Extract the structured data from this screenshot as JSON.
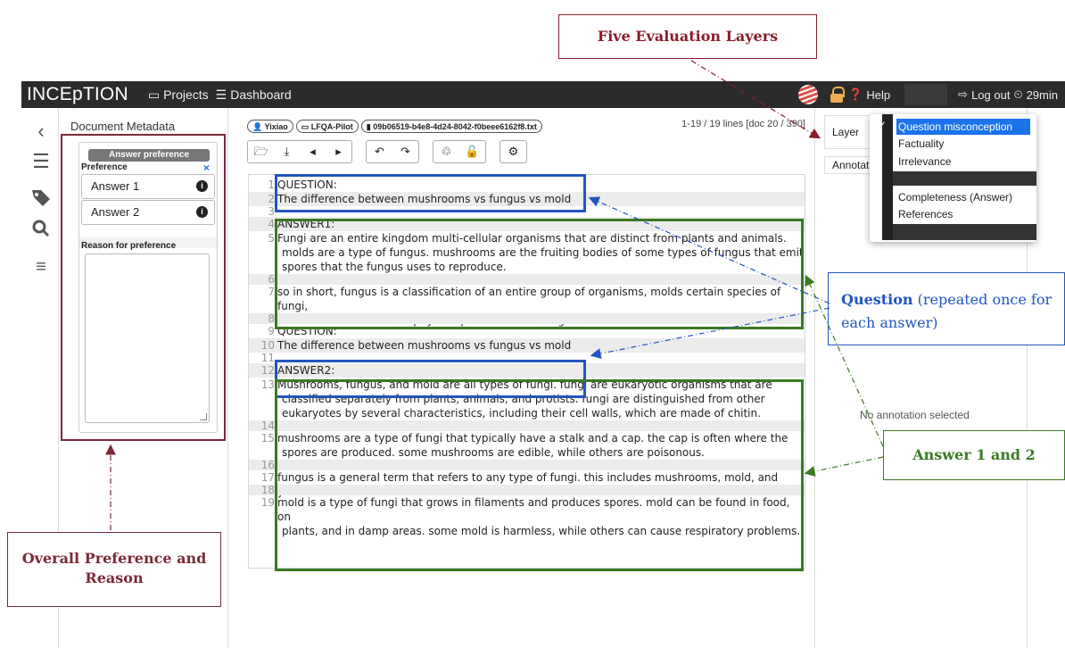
{
  "navbar": {
    "brand": "INCEpTION",
    "projects": "Projects",
    "dashboard": "Dashboard",
    "help": "Help",
    "logout": "Log out",
    "session_time": "29min"
  },
  "metadata": {
    "title": "Document Metadata",
    "preference_header": "Answer preference",
    "preference_label": "Preference",
    "close": "×",
    "options": [
      "Answer 1",
      "Answer 2"
    ],
    "info": "i",
    "reason_label": "Reason for preference"
  },
  "editor": {
    "badges": [
      "Yixiao",
      "LFQA-Pilot",
      "09b06519-b4e8-4d24-8042-f0beee6162f8.txt"
    ],
    "line_info": "1-19 / 19 lines [doc 20 / 390]",
    "lines": [
      {
        "n": "1",
        "t": "QUESTION:",
        "c": []
      },
      {
        "n": "2",
        "t": "The difference between mushrooms vs fungus vs mold",
        "c": []
      },
      {
        "n": "3",
        "t": "",
        "c": []
      },
      {
        "n": "4",
        "t": "ANSWER1:",
        "c": []
      },
      {
        "n": "5",
        "t": "Fungi are an entire kingdom multi-cellular organisms that are distinct from plants and animals.",
        "c": [
          "molds are a type of fungus. mushrooms are the fruiting bodies of some types of fungus that emit",
          "spores that the fungus uses to reproduce."
        ]
      },
      {
        "n": "6",
        "t": "",
        "c": []
      },
      {
        "n": "7",
        "t": "so in short, fungus is a classification of an entire group of organisms, molds certain species of fungi,",
        "c": [
          "and mushrooms are the physical part of certain fungi."
        ]
      },
      {
        "n": "8",
        "t": "",
        "c": []
      },
      {
        "n": "9",
        "t": "QUESTION:",
        "c": []
      },
      {
        "n": "10",
        "t": "The difference between mushrooms vs fungus vs mold",
        "c": []
      },
      {
        "n": "11",
        "t": "",
        "c": []
      },
      {
        "n": "12",
        "t": "ANSWER2:",
        "c": []
      },
      {
        "n": "13",
        "t": "Mushrooms, fungus, and mold are all types of fungi. fungi are eukaryotic organisms that are",
        "c": [
          "classified separately from plants, animals, and protists. fungi are distinguished from other",
          "eukaryotes by several characteristics, including their cell walls, which are made of chitin."
        ]
      },
      {
        "n": "14",
        "t": "",
        "c": []
      },
      {
        "n": "15",
        "t": "mushrooms are a type of fungi that typically have a stalk and a cap. the cap is often where the",
        "c": [
          "spores are produced. some mushrooms are edible, while others are poisonous."
        ]
      },
      {
        "n": "16",
        "t": "",
        "c": []
      },
      {
        "n": "17",
        "t": "fungus is a general term that refers to any type of fungi. this includes mushrooms, mold, and yeast.",
        "c": []
      },
      {
        "n": "18",
        "t": "",
        "c": []
      },
      {
        "n": "19",
        "t": "mold is a type of fungi that grows in filaments and produces spores. mold can be found in food, on",
        "c": [
          "plants, and in damp areas. some mold is harmless, while others can cause respiratory problems."
        ]
      }
    ]
  },
  "right_panel": {
    "layer_label": "Layer",
    "annotation_header": "Annotat",
    "no_annotation": "No annotation selected",
    "layers": [
      "Question misconception",
      "Factuality",
      "Irrelevance",
      "Completeness (Answer)",
      "References"
    ]
  },
  "callouts": {
    "five_layers": "Five Evaluation Layers",
    "question_bold": "Question",
    "question_rest": " (repeated once for each answer)",
    "answers": "Answer 1 and 2",
    "overall": "Overall Preference and Reason"
  },
  "colors": {
    "question_box": "#2155c0",
    "answer_box": "#3a7a22",
    "layers_callout": "#8a1c2a",
    "preference_callout": "#7a2a3a",
    "navbar": "#2b2b2b",
    "selected_layer": "#1a73e8"
  }
}
